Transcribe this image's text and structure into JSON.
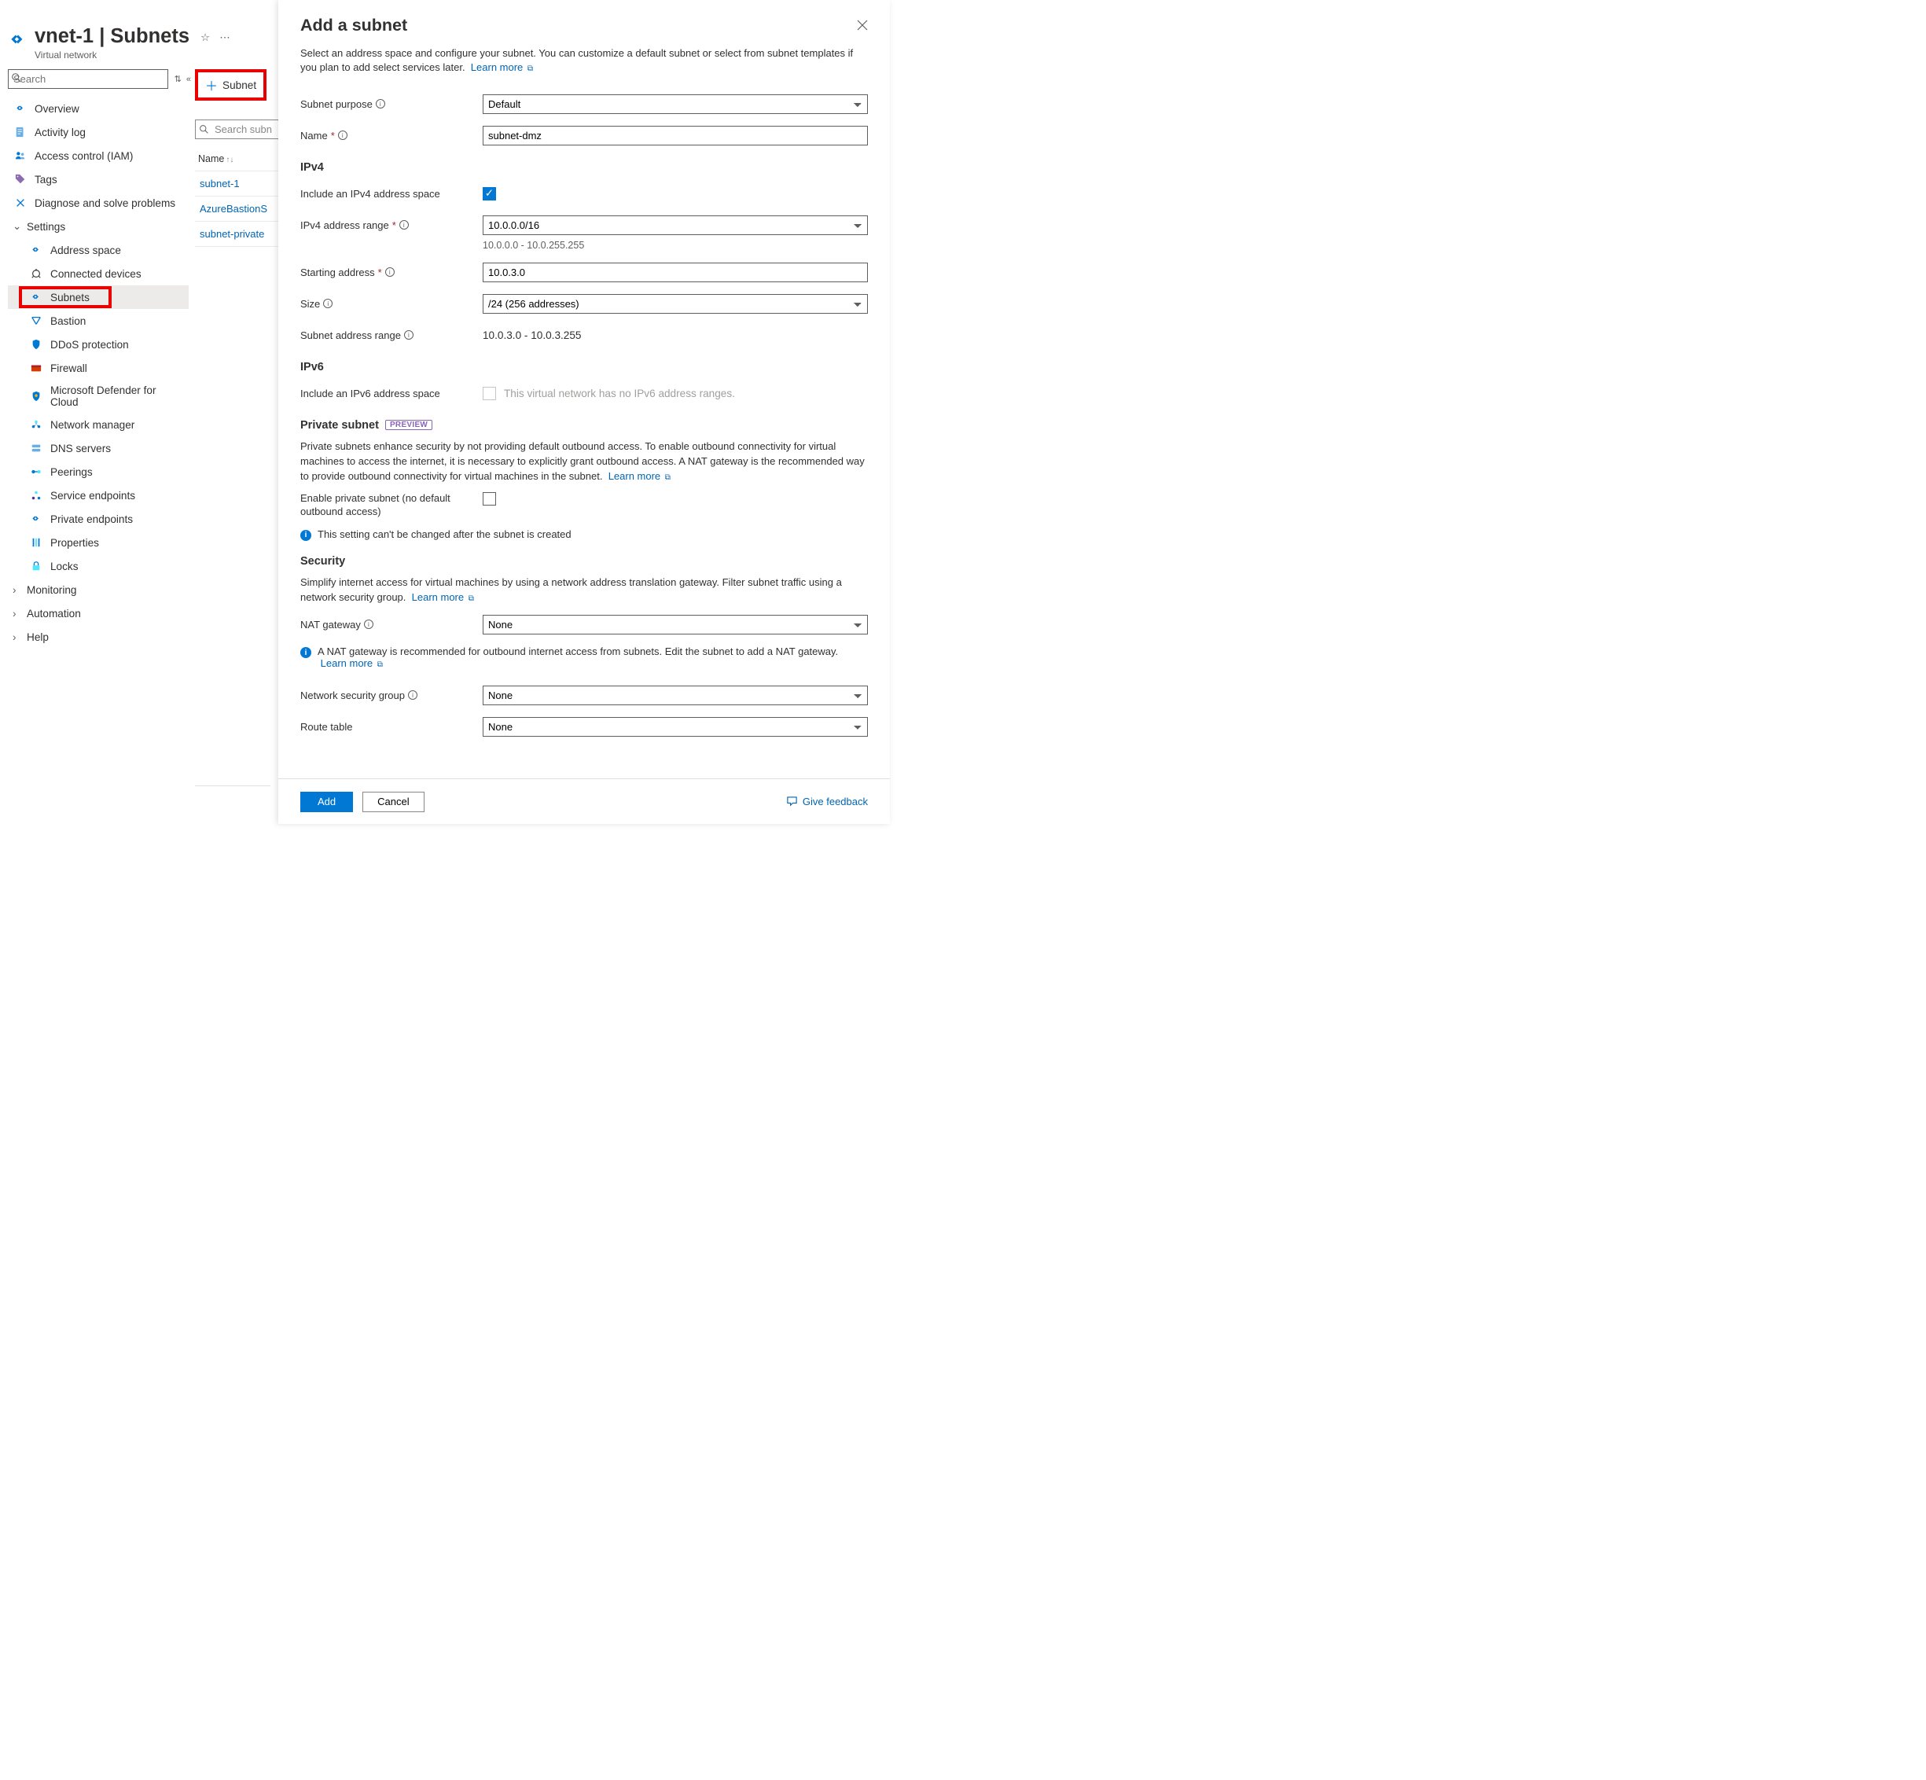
{
  "header": {
    "title": "vnet-1 | Subnets",
    "subtitle": "Virtual network"
  },
  "search": {
    "placeholder": "Search"
  },
  "nav": {
    "overview": "Overview",
    "activity": "Activity log",
    "iam": "Access control (IAM)",
    "tags": "Tags",
    "diag": "Diagnose and solve problems",
    "settings": "Settings",
    "settings_children": {
      "addr": "Address space",
      "devices": "Connected devices",
      "subnets": "Subnets",
      "bastion": "Bastion",
      "ddos": "DDoS protection",
      "firewall": "Firewall",
      "defender": "Microsoft Defender for Cloud",
      "netmgr": "Network manager",
      "dns": "DNS servers",
      "peerings": "Peerings",
      "sep": "Service endpoints",
      "pep": "Private endpoints",
      "props": "Properties",
      "locks": "Locks"
    },
    "monitoring": "Monitoring",
    "automation": "Automation",
    "help": "Help"
  },
  "center": {
    "add_subnet_btn": "Subnet",
    "search_placeholder": "Search subn",
    "col_name": "Name",
    "rows": [
      "subnet-1",
      "AzureBastionS",
      "subnet-private"
    ]
  },
  "panel": {
    "title": "Add a subnet",
    "intro": "Select an address space and configure your subnet. You can customize a default subnet or select from subnet templates if you plan to add select services later.",
    "learn_more": "Learn more",
    "labels": {
      "purpose": "Subnet purpose",
      "name": "Name",
      "ipv4_h": "IPv4",
      "incl_ipv4": "Include an IPv4 address space",
      "ipv4_range": "IPv4 address range",
      "starting": "Starting address",
      "size": "Size",
      "subnet_range": "Subnet address range",
      "ipv6_h": "IPv6",
      "incl_ipv6": "Include an IPv6 address space",
      "ipv6_note": "This virtual network has no IPv6 address ranges.",
      "private_h": "Private subnet",
      "preview_badge": "PREVIEW",
      "private_desc": "Private subnets enhance security by not providing default outbound access. To enable outbound connectivity for virtual machines to access the internet, it is necessary to explicitly grant outbound access. A NAT gateway is the recommended way to provide outbound connectivity for virtual machines in the subnet.",
      "enable_private": "Enable private subnet (no default outbound access)",
      "private_info": "This setting can't be changed after the subnet is created",
      "security_h": "Security",
      "security_desc": "Simplify internet access for virtual machines by using a network address translation gateway. Filter subnet traffic using a network security group.",
      "nat": "NAT gateway",
      "nat_info": "A NAT gateway is recommended for outbound internet access from subnets. Edit the subnet to add a NAT gateway.",
      "nsg": "Network security group",
      "route": "Route table"
    },
    "values": {
      "purpose": "Default",
      "name": "subnet-dmz",
      "ipv4_range": "10.0.0.0/16",
      "ipv4_range_note": "10.0.0.0 - 10.0.255.255",
      "starting": "10.0.3.0",
      "size": "/24 (256 addresses)",
      "subnet_range_val": "10.0.3.0 - 10.0.3.255",
      "nat": "None",
      "nsg": "None",
      "route": "None"
    },
    "buttons": {
      "add": "Add",
      "cancel": "Cancel",
      "feedback": "Give feedback"
    }
  }
}
